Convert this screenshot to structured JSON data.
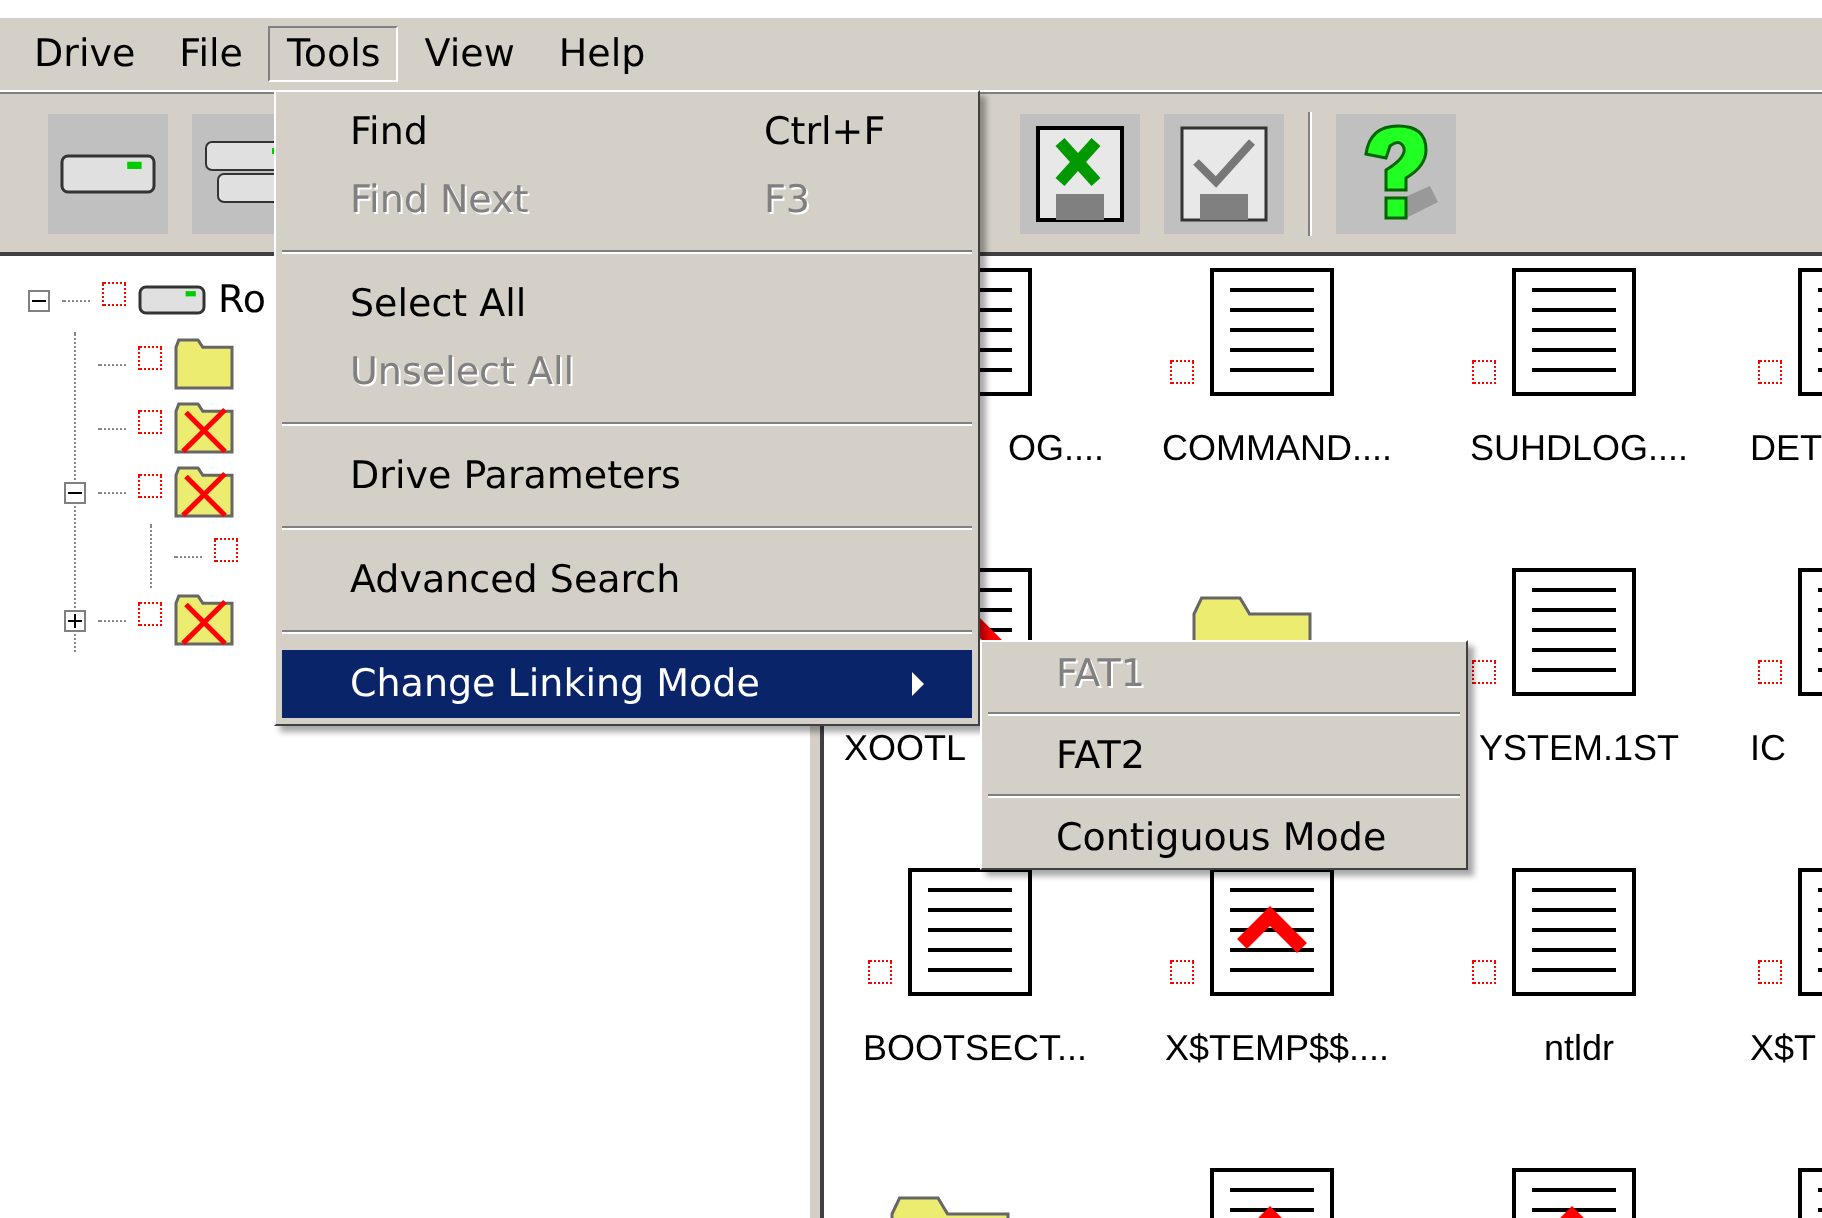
{
  "menubar": [
    {
      "label": "Drive",
      "selected": false
    },
    {
      "label": "File",
      "selected": false
    },
    {
      "label": "Tools",
      "selected": true
    },
    {
      "label": "View",
      "selected": false
    },
    {
      "label": "Help",
      "selected": false
    }
  ],
  "toolbar": [
    {
      "kind": "drive"
    },
    {
      "kind": "drives"
    },
    {
      "kind": "gap"
    },
    {
      "kind": "floppy-x"
    },
    {
      "kind": "floppy-check"
    },
    {
      "kind": "separator"
    },
    {
      "kind": "help"
    }
  ],
  "tree": {
    "label": "Ro",
    "kind": "drive",
    "expanded": true,
    "checked": false,
    "children": [
      {
        "kind": "folder",
        "checked": false
      },
      {
        "kind": "folder",
        "deleted": true,
        "checked": false
      },
      {
        "kind": "folder",
        "deleted": true,
        "expanded": true,
        "checked": false,
        "children": [
          {
            "checked": false
          }
        ]
      },
      {
        "kind": "folder",
        "deleted": true,
        "expanded": false,
        "checked": false
      }
    ]
  },
  "files": [
    {
      "label": "OG....",
      "kind": "document"
    },
    {
      "label": "COMMAND....",
      "kind": "document",
      "checked": false
    },
    {
      "label": "SUHDLOG....",
      "kind": "document",
      "checked": false
    },
    {
      "label": "DET",
      "kind": "document",
      "checked": false
    },
    {
      "label": "XOOTL",
      "kind": "document",
      "deleted": true
    },
    {
      "kind": "folder"
    },
    {
      "label": "YSTEM.1ST",
      "kind": "document",
      "checked": false
    },
    {
      "label": "IC",
      "kind": "document",
      "checked": false
    },
    {
      "label": "BOOTSECT...",
      "kind": "document",
      "checked": false
    },
    {
      "label": "X$TEMP$$....",
      "kind": "document",
      "deleted": true,
      "checked": false
    },
    {
      "label": "ntldr",
      "kind": "document",
      "checked": false
    },
    {
      "label": "X$T",
      "kind": "document",
      "checked": false
    },
    {
      "kind": "folder"
    },
    {
      "kind": "document",
      "deleted": true
    },
    {
      "kind": "document",
      "deleted": true
    },
    {
      "kind": "document"
    }
  ],
  "tools_menu": [
    {
      "kind": "item",
      "label": "Find",
      "shortcut": "Ctrl+F",
      "disabled": false,
      "selected": false
    },
    {
      "kind": "item",
      "label": "Find Next",
      "shortcut": "F3",
      "disabled": true,
      "selected": false
    },
    {
      "kind": "separator"
    },
    {
      "kind": "item",
      "label": "Select All",
      "disabled": false,
      "selected": false
    },
    {
      "kind": "item",
      "label": "Unselect All",
      "disabled": true,
      "selected": false
    },
    {
      "kind": "separator"
    },
    {
      "kind": "item",
      "label": "Drive Parameters",
      "disabled": false,
      "selected": false
    },
    {
      "kind": "separator"
    },
    {
      "kind": "item",
      "label": "Advanced Search",
      "disabled": false,
      "selected": false
    },
    {
      "kind": "separator"
    },
    {
      "kind": "item",
      "label": "Change Linking Mode",
      "disabled": false,
      "selected": true,
      "submenu": true
    }
  ],
  "submenu": [
    {
      "kind": "item",
      "label": "FAT1",
      "disabled": true,
      "selected": false
    },
    {
      "kind": "separator"
    },
    {
      "kind": "item",
      "label": "FAT2",
      "disabled": false,
      "selected": false
    },
    {
      "kind": "separator"
    },
    {
      "kind": "item",
      "label": "Contiguous Mode",
      "disabled": false,
      "selected": false
    }
  ]
}
